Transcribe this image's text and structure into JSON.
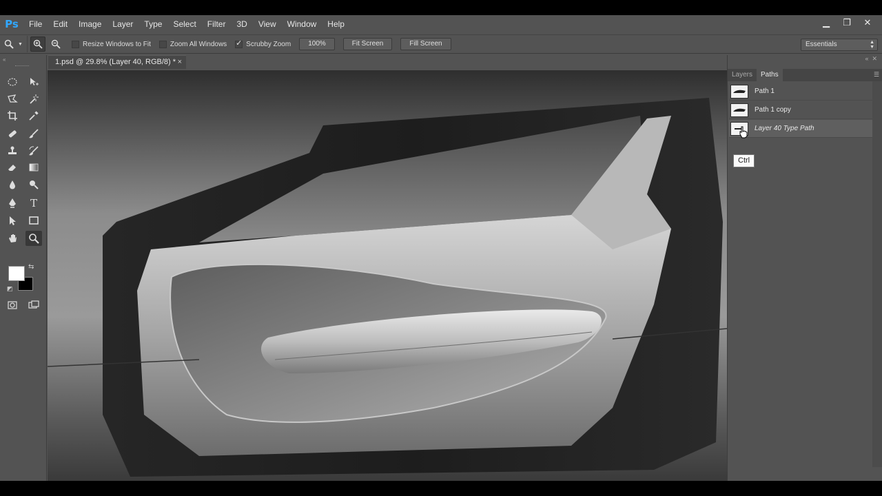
{
  "app": {
    "logo": "Ps"
  },
  "menu": [
    "File",
    "Edit",
    "Image",
    "Layer",
    "Type",
    "Select",
    "Filter",
    "3D",
    "View",
    "Window",
    "Help"
  ],
  "window_controls": {
    "minimize": "▁",
    "restore": "❐",
    "close": "✕"
  },
  "options": {
    "resize_windows": "Resize Windows to Fit",
    "resize_windows_checked": false,
    "zoom_all": "Zoom All Windows",
    "zoom_all_checked": false,
    "scrubby_zoom": "Scrubby Zoom",
    "scrubby_zoom_checked": true,
    "zoom_100": "100%",
    "fit_screen": "Fit Screen",
    "fill_screen": "Fill Screen",
    "workspace": "Essentials"
  },
  "document": {
    "tab_title": "1.psd @ 29.8% (Layer 40, RGB/8) *",
    "close": "×"
  },
  "panels": {
    "tabs": [
      "Layers",
      "Paths"
    ],
    "active_tab": "Paths",
    "paths": [
      {
        "name": "Path 1",
        "italic": false,
        "selected": false
      },
      {
        "name": "Path 1 copy",
        "italic": false,
        "selected": false
      },
      {
        "name": "Layer 40 Type Path",
        "italic": true,
        "selected": true
      }
    ]
  },
  "tooltip": "Ctrl",
  "colors": {
    "foreground": "#ffffff",
    "background": "#000000",
    "ps_blue": "#31a8ff"
  }
}
